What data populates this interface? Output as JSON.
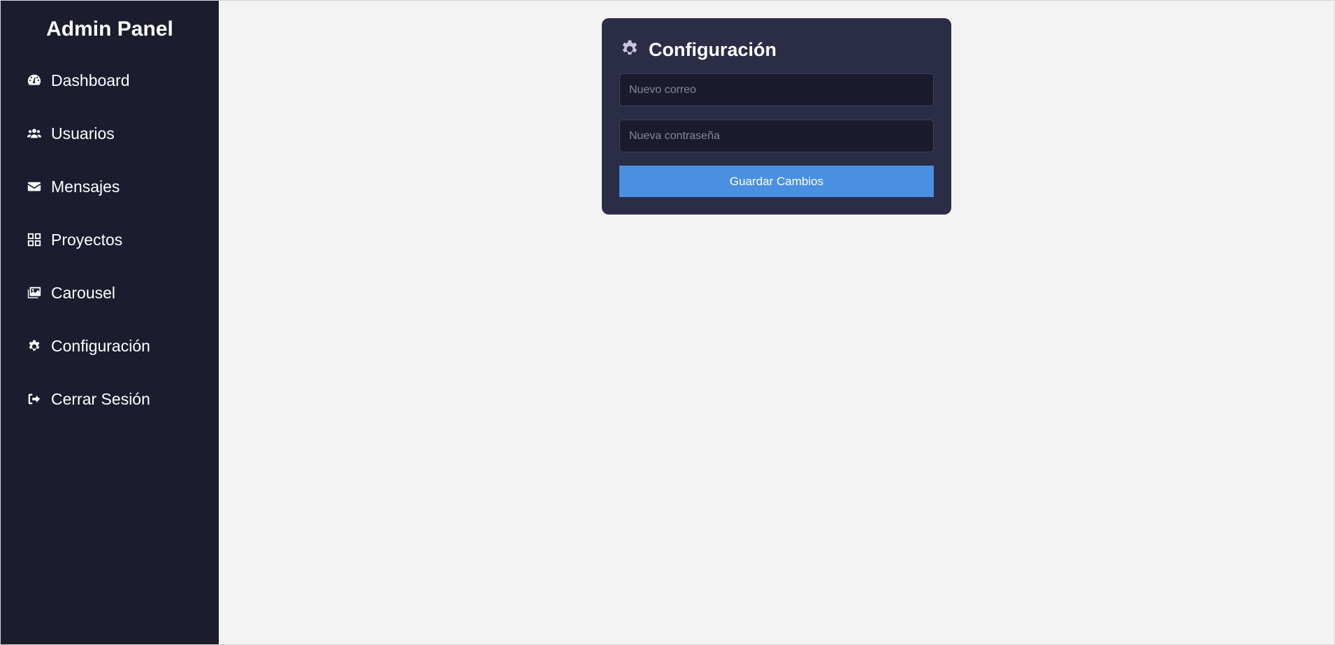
{
  "sidebar": {
    "title": "Admin Panel",
    "items": [
      {
        "label": "Dashboard",
        "icon": "dashboard-icon"
      },
      {
        "label": "Usuarios",
        "icon": "users-icon"
      },
      {
        "label": "Mensajes",
        "icon": "envelope-icon"
      },
      {
        "label": "Proyectos",
        "icon": "grid-icon"
      },
      {
        "label": "Carousel",
        "icon": "images-icon"
      },
      {
        "label": "Configuración",
        "icon": "gear-icon"
      },
      {
        "label": "Cerrar Sesión",
        "icon": "logout-icon"
      }
    ]
  },
  "settings": {
    "title": "Configuración",
    "icon": "gear-icon",
    "email_placeholder": "Nuevo correo",
    "email_value": "",
    "password_placeholder": "Nueva contraseña",
    "password_value": "",
    "save_label": "Guardar Cambios"
  },
  "colors": {
    "sidebar_bg": "#1b1c2e",
    "card_bg": "#2b2c45",
    "main_bg": "#f3f3f3",
    "accent": "#4a90e2"
  }
}
